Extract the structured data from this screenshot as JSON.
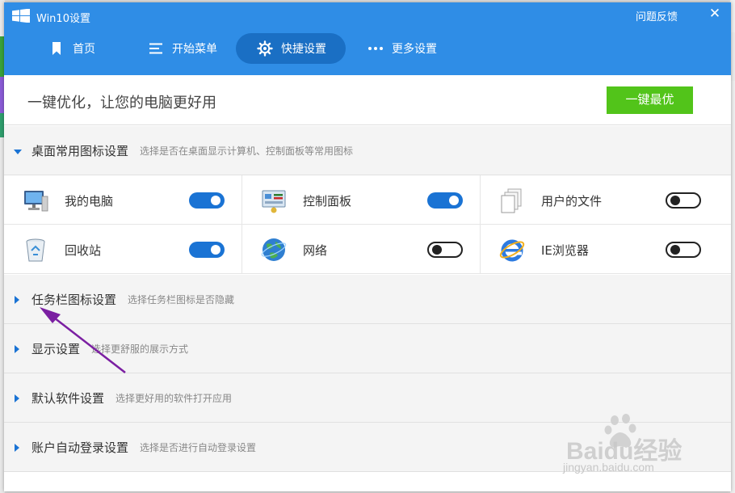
{
  "window": {
    "title": "Win10设置",
    "feedback": "问题反馈",
    "close": "✕"
  },
  "nav": {
    "items": [
      {
        "label": "首页",
        "icon": "bookmark-icon"
      },
      {
        "label": "开始菜单",
        "icon": "menu-icon"
      },
      {
        "label": "快捷设置",
        "icon": "gear-icon",
        "active": true
      },
      {
        "label": "更多设置",
        "icon": "more-icon"
      }
    ]
  },
  "panel": {
    "slogan": "一键优化，让您的电脑更好用",
    "optimize_button": "一键最优"
  },
  "sections": [
    {
      "title": "桌面常用图标设置",
      "desc": "选择是否在桌面显示计算机、控制面板等常用图标",
      "expanded": true
    },
    {
      "title": "任务栏图标设置",
      "desc": "选择任务栏图标是否隐藏",
      "expanded": false
    },
    {
      "title": "显示设置",
      "desc": "选择更舒服的展示方式",
      "expanded": false
    },
    {
      "title": "默认软件设置",
      "desc": "选择更好用的软件打开应用",
      "expanded": false
    },
    {
      "title": "账户自动登录设置",
      "desc": "选择是否进行自动登录设置",
      "expanded": false
    }
  ],
  "desktop_icons": [
    {
      "label": "我的电脑",
      "icon": "computer-icon",
      "enabled": true
    },
    {
      "label": "控制面板",
      "icon": "control-panel-icon",
      "enabled": true
    },
    {
      "label": "用户的文件",
      "icon": "documents-icon",
      "enabled": false
    },
    {
      "label": "回收站",
      "icon": "recycle-bin-icon",
      "enabled": true
    },
    {
      "label": "网络",
      "icon": "network-globe-icon",
      "enabled": false
    },
    {
      "label": "IE浏览器",
      "icon": "ie-browser-icon",
      "enabled": false
    }
  ],
  "colors": {
    "header_blue": "#2f8de6",
    "active_nav": "#1a6fc4",
    "toggle_on": "#1a73d4",
    "optimize_green": "#52c41a",
    "annotation_arrow": "#7b1fa2"
  },
  "watermark": {
    "brand": "Baidu经验",
    "domain": "jingyan.baidu.com"
  }
}
